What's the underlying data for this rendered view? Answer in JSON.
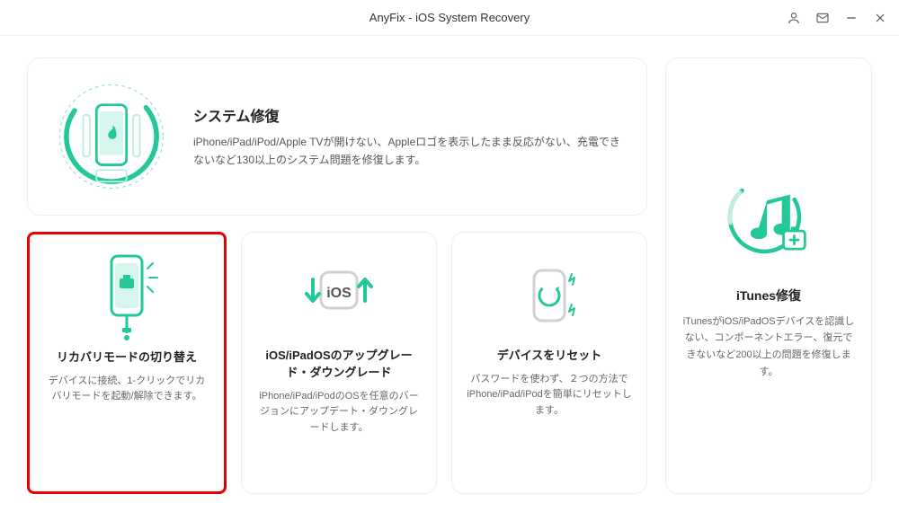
{
  "titlebar": {
    "title": "AnyFix - iOS System Recovery"
  },
  "hero": {
    "title": "システム修復",
    "desc": "iPhone/iPad/iPod/Apple TVが開けない、Appleロゴを表示したまま反応がない、充電できないなど130以上のシステム問題を修復します。"
  },
  "cards": {
    "recovery": {
      "title": "リカバリモードの切り替え",
      "desc": "デバイスに接続、1-クリックでリカバリモードを起動/解除できます。"
    },
    "upgrade": {
      "title": "iOS/iPadOSのアップグレード・ダウングレード",
      "desc": "iPhone/iPad/iPodのOSを任意のバージョンにアップデート・ダウングレードします。"
    },
    "reset": {
      "title": "デバイスをリセット",
      "desc": "パスワードを使わず、２つの方法でiPhone/iPad/iPodを簡単にリセットします。"
    },
    "itunes": {
      "title": "iTunes修復",
      "desc": "iTunesがiOS/iPadOSデバイスを認識しない、コンポーネントエラー、復元できないなど200以上の問題を修復します。"
    }
  }
}
